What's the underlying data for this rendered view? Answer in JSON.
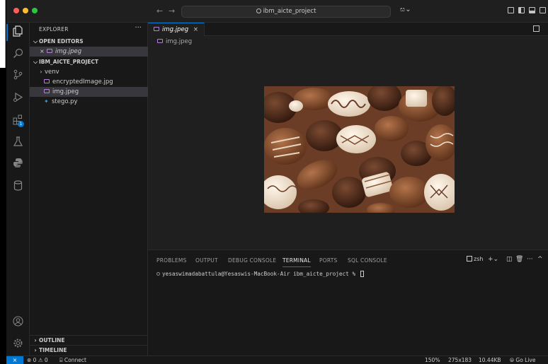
{
  "titlebar": {
    "search_text": "ibm_aicte_project",
    "back_icon": "arrow-left-icon",
    "forward_icon": "arrow-right-icon",
    "traffic_colors": [
      "#ff5f57",
      "#febc2e",
      "#28c840"
    ]
  },
  "activity": {
    "extensions_badge": "1",
    "accent": "#0078d4"
  },
  "sidebar": {
    "title": "EXPLORER",
    "more": "···",
    "open_editors": {
      "header": "OPEN EDITORS",
      "items": [
        {
          "close": "×",
          "label": "img.jpeg"
        }
      ]
    },
    "project": {
      "header": "IBM_AICTE_PROJECT",
      "items": [
        {
          "label": "venv",
          "kind": "folder"
        },
        {
          "label": "encryptedImage.jpg",
          "kind": "image"
        },
        {
          "label": "img.jpeg",
          "kind": "image"
        },
        {
          "label": "stego.py",
          "kind": "python"
        }
      ]
    },
    "outline": "OUTLINE",
    "timeline": "TIMELINE"
  },
  "editor": {
    "tab_label": "img.jpeg",
    "tab_close": "×",
    "breadcrumb": "img.jpeg"
  },
  "panel": {
    "tabs": [
      "PROBLEMS",
      "OUTPUT",
      "DEBUG CONSOLE",
      "TERMINAL",
      "PORTS",
      "SQL CONSOLE"
    ],
    "active_tab": "TERMINAL",
    "shell": "zsh",
    "terminal_line": "yesaswimadabattula@Yesaswis-MacBook-Air ibm_aicte_project % "
  },
  "statusbar": {
    "problems": "⊗ 0 ⚠ 0",
    "connect": "Connect",
    "zoom": "150%",
    "dimensions": "275x183",
    "size": "10.44KB",
    "golive": "Go Live"
  }
}
